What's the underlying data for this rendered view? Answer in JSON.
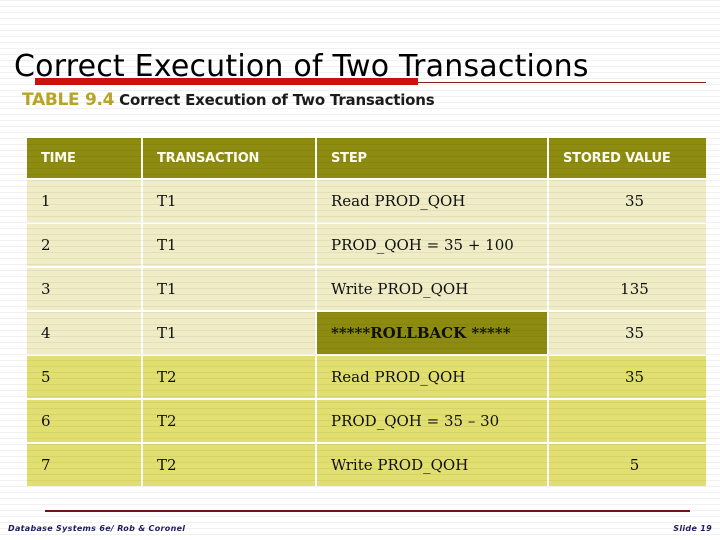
{
  "slide": {
    "title": "Correct Execution of Two Transactions",
    "accent_color": "#cc1111",
    "header_band_color": "#8d8c10",
    "row_light_color": "#efecc6",
    "row_dark_color": "#e2df71"
  },
  "table": {
    "caption_number": "TABLE 9.4",
    "caption_title": "Correct Execution of Two Transactions",
    "columns": [
      "TIME",
      "TRANSACTION",
      "STEP",
      "STORED VALUE"
    ],
    "rows": [
      {
        "time": "1",
        "transaction": "T1",
        "step": "Read PROD_QOH",
        "stored_value": "35",
        "band": "light",
        "highlight": false
      },
      {
        "time": "2",
        "transaction": "T1",
        "step": "PROD_QOH = 35 + 100",
        "stored_value": "",
        "band": "light",
        "highlight": false
      },
      {
        "time": "3",
        "transaction": "T1",
        "step": "Write PROD_QOH",
        "stored_value": "135",
        "band": "light",
        "highlight": false
      },
      {
        "time": "4",
        "transaction": "T1",
        "step": "*****ROLLBACK *****",
        "stored_value": "35",
        "band": "light",
        "highlight": true
      },
      {
        "time": "5",
        "transaction": "T2",
        "step": "Read PROD_QOH",
        "stored_value": "35",
        "band": "dark",
        "highlight": false
      },
      {
        "time": "6",
        "transaction": "T2",
        "step": "PROD_QOH = 35 – 30",
        "stored_value": "",
        "band": "dark",
        "highlight": false
      },
      {
        "time": "7",
        "transaction": "T2",
        "step": "Write PROD_QOH",
        "stored_value": "5",
        "band": "dark",
        "highlight": false
      }
    ]
  },
  "footer": {
    "left": "Database Systems 6e/ Rob & Coronel",
    "right": "Slide 19"
  }
}
